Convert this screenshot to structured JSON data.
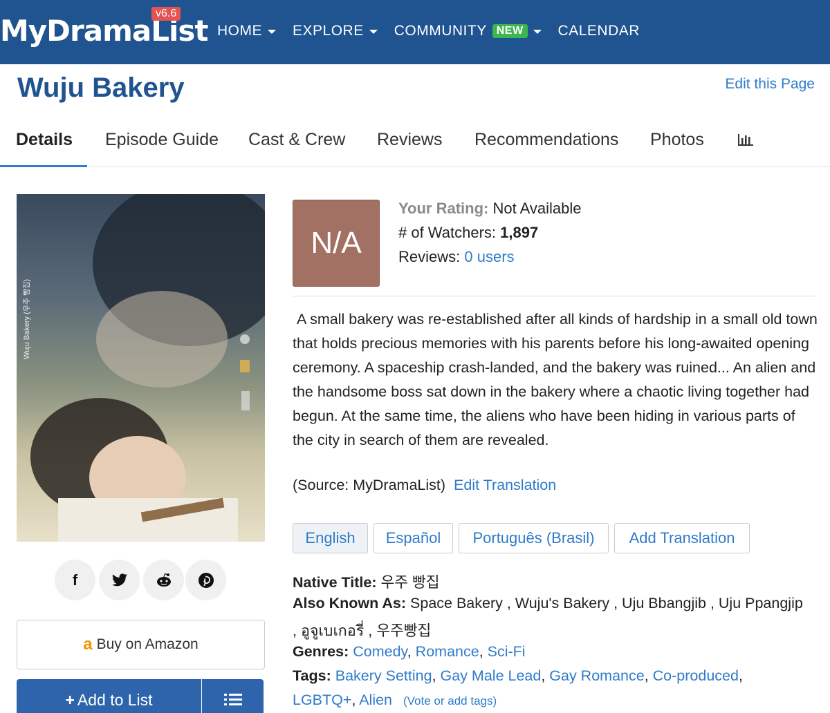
{
  "app": {
    "logo": "MyDramaList",
    "version": "v6.6"
  },
  "nav": {
    "items": [
      {
        "label": "HOME",
        "dropdown": true
      },
      {
        "label": "EXPLORE",
        "dropdown": true
      },
      {
        "label": "COMMUNITY",
        "dropdown": true,
        "badge": "NEW"
      },
      {
        "label": "CALENDAR",
        "dropdown": false
      }
    ]
  },
  "page": {
    "title": "Wuju Bakery",
    "edit_link": "Edit this Page"
  },
  "tabs": [
    {
      "label": "Details",
      "active": true
    },
    {
      "label": "Episode Guide"
    },
    {
      "label": "Cast & Crew"
    },
    {
      "label": "Reviews"
    },
    {
      "label": "Recommendations"
    },
    {
      "label": "Photos"
    }
  ],
  "poster": {
    "side_text": "Wuju Bakery (우주 빵집)"
  },
  "share": {
    "icons": [
      "facebook-icon",
      "twitter-icon",
      "reddit-icon",
      "pinterest-icon"
    ],
    "glyphs": [
      "f",
      "t",
      "r",
      "p"
    ]
  },
  "amazon": {
    "label": "Buy on Amazon",
    "glyph": "a"
  },
  "add_list": {
    "label": "Add to List",
    "plus": "+"
  },
  "rating": {
    "score": "N/A",
    "your_rating_label": "Your Rating:",
    "your_rating_value": "Not Available",
    "watchers_label": "# of Watchers:",
    "watchers_value": "1,897",
    "reviews_label": "Reviews:",
    "reviews_value": "0 users"
  },
  "synopsis": {
    "text": " A small bakery was re-established after all kinds of hardship in a small old town that holds precious memories with his parents before his long-awaited opening ceremony. A spaceship crash-landed, and the bakery was ruined... An alien and the handsome boss sat down in the bakery where a chaotic living together had begun. At the same time, the aliens who have been hiding in various parts of the city in search of them are revealed.",
    "source": "(Source: MyDramaList)",
    "edit_translation": "Edit Translation"
  },
  "languages": [
    {
      "label": "English",
      "active": true
    },
    {
      "label": "Español"
    },
    {
      "label": "Português (Brasil)"
    },
    {
      "label": "Add Translation"
    }
  ],
  "details": {
    "native_title_label": "Native Title:",
    "native_title": "우주 빵집",
    "aka_label": "Also Known As:",
    "aka_line1": "Space Bakery , Wuju's Bakery , Uju Bbangjib , Uju Ppangjip",
    "aka_line2": ", อูจูเบเกอรี่ , 우주빵집",
    "genres_label": "Genres:",
    "genres": [
      "Comedy",
      "Romance",
      "Sci-Fi"
    ],
    "tags_label": "Tags:",
    "tags_line1": [
      "Bakery Setting",
      "Gay Male Lead",
      "Gay Romance",
      "Co-produced"
    ],
    "tags_line2": [
      "LGBTQ+",
      "Alien"
    ],
    "vote_tags": "(Vote or add tags)"
  },
  "colors": {
    "nav_bg": "#1f5490",
    "link": "#2f7bc9",
    "rating_box": "#a27163",
    "new_badge": "#3eb650",
    "version_badge": "#e55353"
  }
}
